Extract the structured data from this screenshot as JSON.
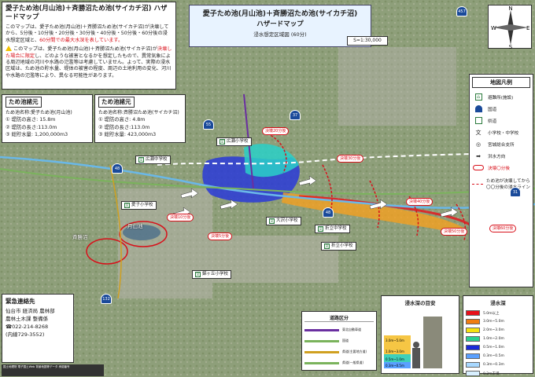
{
  "title": {
    "main": "愛子ため池(月山池)＋斉勝沼ため池(サイカチ沼) ハザードマップ",
    "para1": "このマップは、愛子ため池(月山池)＋斉勝沼ため池(サイカチ沼)が決壊してから、5分後・10分後・20分後・30分後・40分後・50分後・60分後の浸水想定区域と、",
    "para1_red": "60分間での最大水深を表しています。",
    "para2_a": "このマップは、愛子ため池(月山池)＋斉勝沼ため池(サイカチ沼)が",
    "para2_red": "決壊した場合に限定",
    "para2_b": "し、どのような被害となるかを想定したもので、異常気象による周辺地域の河川や水路の氾濫等は考慮していません。よって、実際の浸水区域は、ため池の貯水量、堤体の被害の程度、周辺の土地利用の変化、河川や水路の氾濫等により、異なる可能性があります。"
  },
  "spec_left": {
    "header": "ため池諸元",
    "name": "ため池名称:愛子ため池(月山池)",
    "rows": [
      "① 堤防の高さ: 15.8m",
      "② 堤防の長さ:113.0m",
      "③ 総貯水量: 1,200,000m3"
    ]
  },
  "spec_right": {
    "header": "ため池諸元",
    "name": "ため池名称:斉勝沼ため池(サイカチ沼)",
    "rows": [
      "① 堤防の高さ: 4.8m",
      "② 堤防の長さ:113.0m",
      "③ 総貯水量: 423,000m3"
    ]
  },
  "header": {
    "line1": "愛子ため池(月山池)＋斉勝沼ため池(サイカチ沼)",
    "line2": "ハザードマップ",
    "line3": "浸水想定区域図 (60分)",
    "scale": "S=1:30,000"
  },
  "legend": {
    "title": "地図凡例",
    "items": [
      {
        "label": "避難所(施設)",
        "icon": "shelter-icon"
      },
      {
        "label": "国道",
        "icon": "national-road-icon"
      },
      {
        "label": "県道",
        "icon": "prefectural-road-icon"
      },
      {
        "label": "小学校・中学校",
        "icon": "school-icon"
      },
      {
        "label": "宮城総合支所",
        "icon": "office-icon"
      },
      {
        "label": "洪水方向",
        "icon": "flood-direction-icon"
      },
      {
        "label": "決壊〇分後",
        "icon": "time-label-icon"
      },
      {
        "label": "ため池が決壊してから〇〇分後の浸水ライン",
        "icon": "flood-line-icon"
      }
    ]
  },
  "emergency": {
    "title": "緊急連絡先",
    "org1": "仙台市 経済局 農林部",
    "org2": "農林土木課 整備係",
    "tel": "☎022-214-8268",
    "ext": "(内線729-3552)"
  },
  "footnote": "国土地理院 電子国土Web 背景地図等データ 承認番号",
  "road_legend": {
    "title": "道路区分",
    "items": [
      {
        "label": "東北自動車道",
        "color": "#6a2fa0"
      },
      {
        "label": "国道",
        "color": "#7ab35c"
      },
      {
        "label": "県道(主要地方道)",
        "color": "#d0a020"
      },
      {
        "label": "県道(一般県道)",
        "color": "#7ab35c"
      }
    ]
  },
  "depth_guide": {
    "title": "浸水深の目安",
    "labels": [
      "5.0m以上",
      "3.0m~5.0m",
      "1.0m~3.0m",
      "0.5m~1.0m",
      "0.3m~0.5m",
      "0.3m未満"
    ]
  },
  "depth_legend": {
    "title": "浸水深",
    "rows": [
      {
        "label": "5.0m以上",
        "color": "#e8101a"
      },
      {
        "label": "3.0m~5.0m",
        "color": "#f07d10"
      },
      {
        "label": "2.0m~3.0m",
        "color": "#f5e210"
      },
      {
        "label": "1.0m~2.0m",
        "color": "#2ad090"
      },
      {
        "label": "0.5m~1.0m",
        "color": "#1a2ad8"
      },
      {
        "label": "0.3m~0.5m",
        "color": "#5aa0ff"
      },
      {
        "label": "0.3m~0.3m",
        "color": "#a8d8ff"
      },
      {
        "label": "0.2m未満",
        "color": "#d8f0ff"
      }
    ]
  },
  "schools": [
    {
      "name": "広瀬中学校"
    },
    {
      "name": "広瀬小学校"
    },
    {
      "name": "愛子小学校"
    },
    {
      "name": "大沢小学校"
    },
    {
      "name": "折立中学校"
    },
    {
      "name": "折立小学校"
    },
    {
      "name": "錦ヶ丘小学校"
    }
  ],
  "time_labels": [
    "決壊20分後",
    "決壊30分後",
    "決壊40分後",
    "決壊50分後",
    "決壊60分後",
    "決壊10分後",
    "決壊5分後"
  ],
  "places": {
    "pond1": "月山池",
    "pond2": "斉勝沼"
  },
  "routes": [
    "48",
    "132",
    "31",
    "457",
    "55",
    "37",
    "48"
  ],
  "compass": {
    "n": "N",
    "s": "S",
    "e": "E",
    "w": "W"
  }
}
